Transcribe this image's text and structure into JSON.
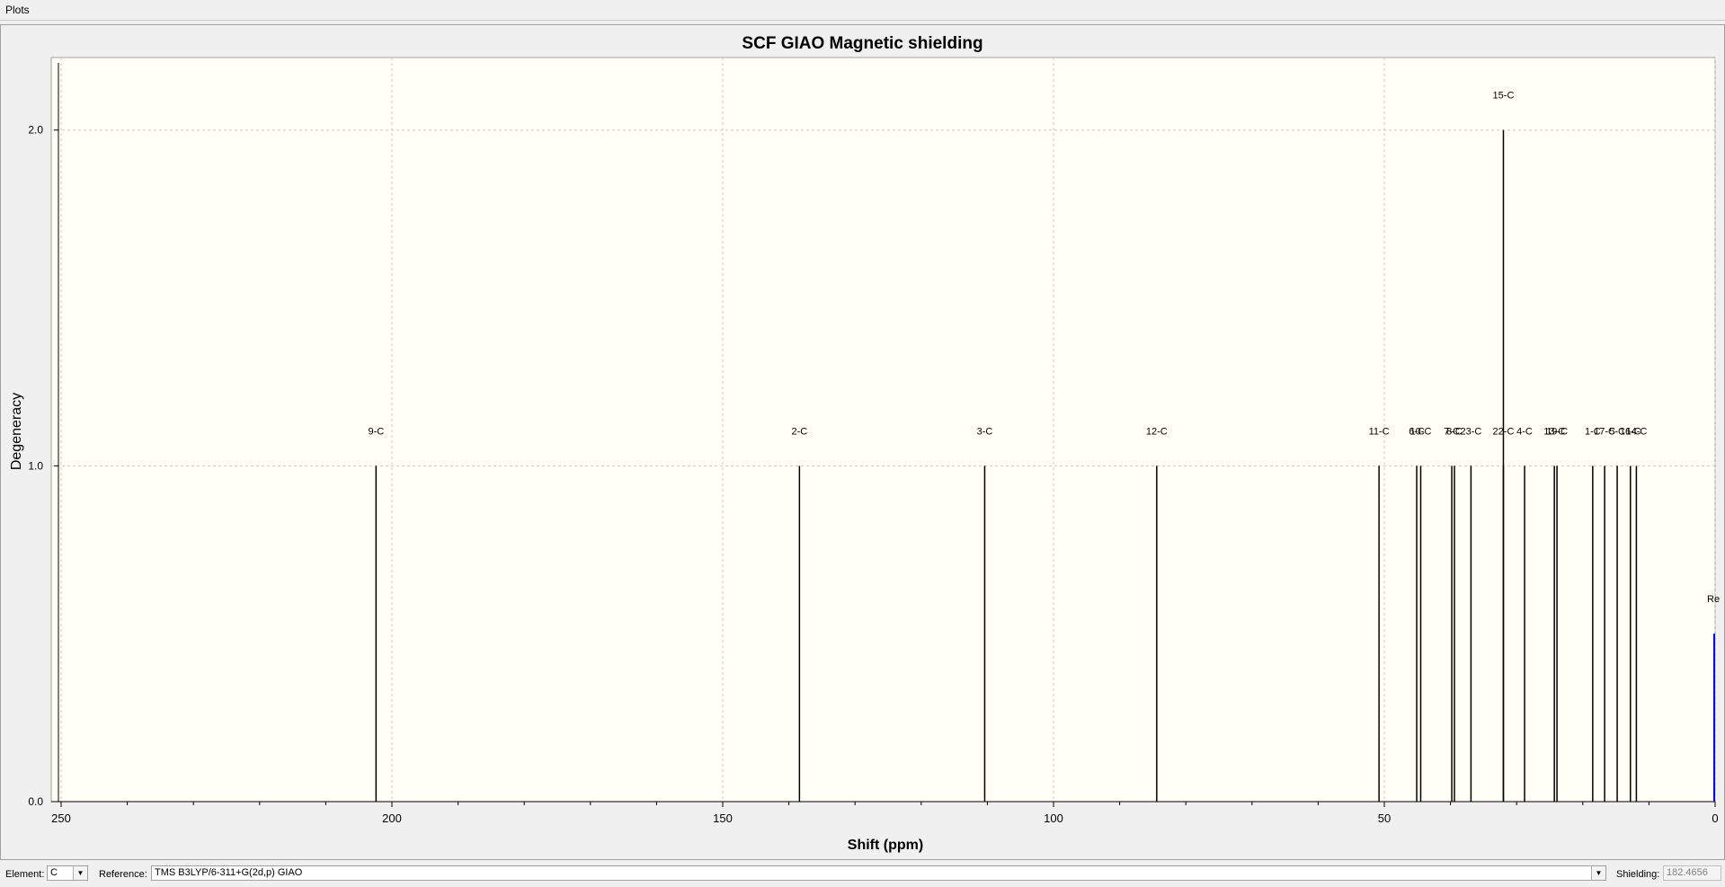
{
  "menu": {
    "plots_label": "Plots"
  },
  "controls": {
    "element_label": "Element:",
    "element_value": "C",
    "reference_label": "Reference:",
    "reference_value": "TMS B3LYP/6-311+G(2d,p) GIAO",
    "shielding_label": "Shielding:",
    "shielding_value": "182.4656"
  },
  "chart_data": {
    "type": "bar",
    "title": "SCF GIAO Magnetic shielding",
    "xlabel": "Shift (ppm)",
    "ylabel": "Degeneracy",
    "xlim": [
      250,
      0
    ],
    "x_reversed": true,
    "ylim": [
      0,
      2.2
    ],
    "x_ticks": [
      "250",
      "200",
      "150",
      "100",
      "50",
      "0"
    ],
    "x_tick_values": [
      250,
      200,
      150,
      100,
      50,
      0
    ],
    "y_ticks": [
      "0.0",
      "1.0",
      "2.0"
    ],
    "y_tick_values": [
      0,
      1,
      2
    ],
    "grid": true,
    "background": "#fffff5",
    "line_color": "#000000",
    "reference_color": "#0000ff",
    "peaks": [
      {
        "label": "9-C",
        "shift": 202.4,
        "degeneracy": 1
      },
      {
        "label": "2-C",
        "shift": 138.4,
        "degeneracy": 1
      },
      {
        "label": "3-C",
        "shift": 110.4,
        "degeneracy": 1
      },
      {
        "label": "12-C",
        "shift": 84.4,
        "degeneracy": 1
      },
      {
        "label": "11-C",
        "shift": 50.8,
        "degeneracy": 1
      },
      {
        "label": "6-C",
        "shift": 45.1,
        "degeneracy": 1
      },
      {
        "label": "10-C",
        "shift": 44.5,
        "degeneracy": 1
      },
      {
        "label": "7-C",
        "shift": 39.8,
        "degeneracy": 1
      },
      {
        "label": "8-C",
        "shift": 39.4,
        "degeneracy": 1
      },
      {
        "label": "23-C",
        "shift": 36.9,
        "degeneracy": 1
      },
      {
        "label": "15-C",
        "shift": 32.0,
        "degeneracy": 2
      },
      {
        "label": "22-C",
        "shift": 32.0,
        "degeneracy": 1
      },
      {
        "label": "4-C",
        "shift": 28.8,
        "degeneracy": 1
      },
      {
        "label": "13-C",
        "shift": 24.3,
        "degeneracy": 1
      },
      {
        "label": "19-C",
        "shift": 23.9,
        "degeneracy": 1
      },
      {
        "label": "1-C",
        "shift": 18.5,
        "degeneracy": 1
      },
      {
        "label": "17-C",
        "shift": 16.7,
        "degeneracy": 1
      },
      {
        "label": "5-C",
        "shift": 14.8,
        "degeneracy": 1
      },
      {
        "label": "16-C",
        "shift": 12.8,
        "degeneracy": 1
      },
      {
        "label": "14-C",
        "shift": 11.9,
        "degeneracy": 1
      }
    ],
    "reference": {
      "label": "Re",
      "shift": 0,
      "degeneracy": 0.5
    }
  }
}
